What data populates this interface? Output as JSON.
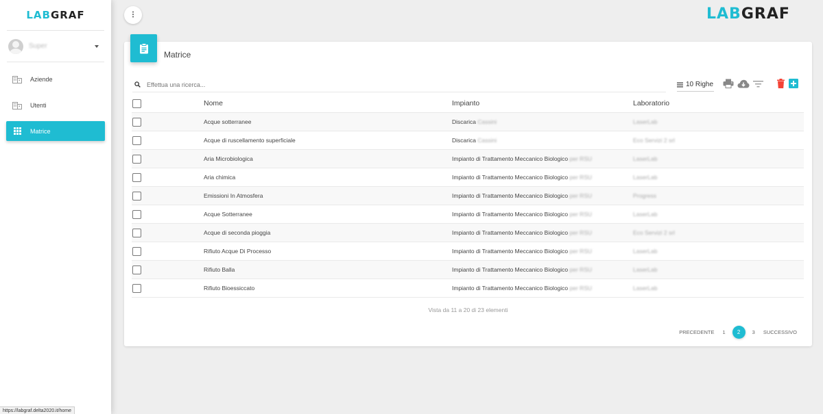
{
  "brand": {
    "lab": "LAB",
    "graf": "GRAF",
    "accent": "#1fbcd2"
  },
  "sidebar": {
    "user": {
      "name": "Super"
    },
    "items": [
      {
        "label": "Aziende",
        "icon": "building-icon",
        "active": false
      },
      {
        "label": "Utenti",
        "icon": "building-icon",
        "active": false
      },
      {
        "label": "Matrice",
        "icon": "grid-icon",
        "active": true
      }
    ]
  },
  "card": {
    "title": "Matrice",
    "search_placeholder": "Effettua una ricerca...",
    "rows_label": "10 Righe"
  },
  "table": {
    "headers": {
      "nome": "Nome",
      "impianto": "Impianto",
      "laboratorio": "Laboratorio"
    },
    "rows": [
      {
        "nome": "Acque sotterranee",
        "impianto": "Discarica",
        "impianto_extra": "Cassini",
        "laboratorio": "LaserLab"
      },
      {
        "nome": "Acque di ruscellamento superficiale",
        "impianto": "Discarica",
        "impianto_extra": "Cassini",
        "laboratorio": "Eco Servizi 2 srl"
      },
      {
        "nome": "Aria Microbiologica",
        "impianto": "Impianto di Trattamento Meccanico Biologico",
        "impianto_extra": "per RSU",
        "laboratorio": "LaserLab"
      },
      {
        "nome": "Aria chimica",
        "impianto": "Impianto di Trattamento Meccanico Biologico",
        "impianto_extra": "per RSU",
        "laboratorio": "LaserLab"
      },
      {
        "nome": "Emissioni In Atmosfera",
        "impianto": "Impianto di Trattamento Meccanico Biologico",
        "impianto_extra": "per RSU",
        "laboratorio": "Progress"
      },
      {
        "nome": "Acque Sotterranee",
        "impianto": "Impianto di Trattamento Meccanico Biologico",
        "impianto_extra": "per RSU",
        "laboratorio": "LaserLab"
      },
      {
        "nome": "Acque di seconda pioggia",
        "impianto": "Impianto di Trattamento Meccanico Biologico",
        "impianto_extra": "per RSU",
        "laboratorio": "Eco Servizi 2 srl"
      },
      {
        "nome": "Rifiuto Acque Di Processo",
        "impianto": "Impianto di Trattamento Meccanico Biologico",
        "impianto_extra": "per RSU",
        "laboratorio": "LaserLab"
      },
      {
        "nome": "Rifiuto Balla",
        "impianto": "Impianto di Trattamento Meccanico Biologico",
        "impianto_extra": "per RSU",
        "laboratorio": "LaserLab"
      },
      {
        "nome": "Rifiuto Bioessiccato",
        "impianto": "Impianto di Trattamento Meccanico Biologico",
        "impianto_extra": "per RSU",
        "laboratorio": "LaserLab"
      }
    ]
  },
  "footer": {
    "info": "Vista da 11 a 20 di 23 elementi",
    "prev": "PRECEDENTE",
    "pages": [
      "1",
      "2",
      "3"
    ],
    "current_page": "2",
    "next": "SUCCESSIVO"
  },
  "status_url": "https://labgraf.delta2020.it/home"
}
